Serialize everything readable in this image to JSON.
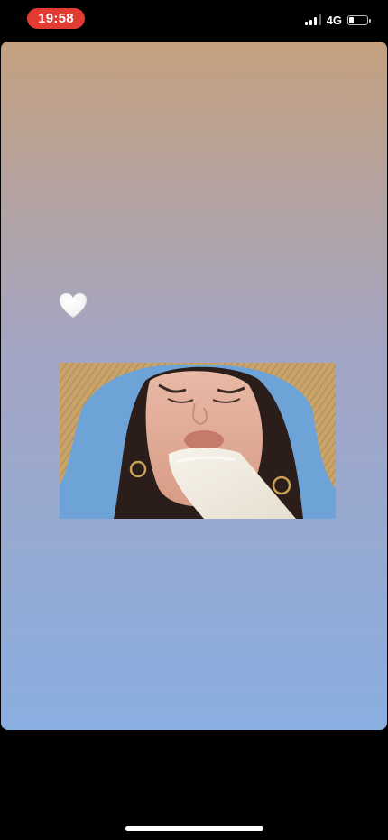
{
  "status_bar": {
    "time": "19:58",
    "network": "4G",
    "battery_level": 0.3,
    "time_pill_color": "#e23b33"
  },
  "story": {
    "background_gradient": [
      "#c4a07e",
      "#a3a5c4",
      "#89aee0"
    ],
    "sticker": {
      "icon": "white-heart-icon",
      "color": "#ffffff"
    },
    "photo": {
      "hat_color": "#c9a46a",
      "sky_color": "#6ea3d8",
      "popsicle_color": "#f1ece2"
    }
  },
  "home_indicator": {
    "color": "#ffffff"
  }
}
